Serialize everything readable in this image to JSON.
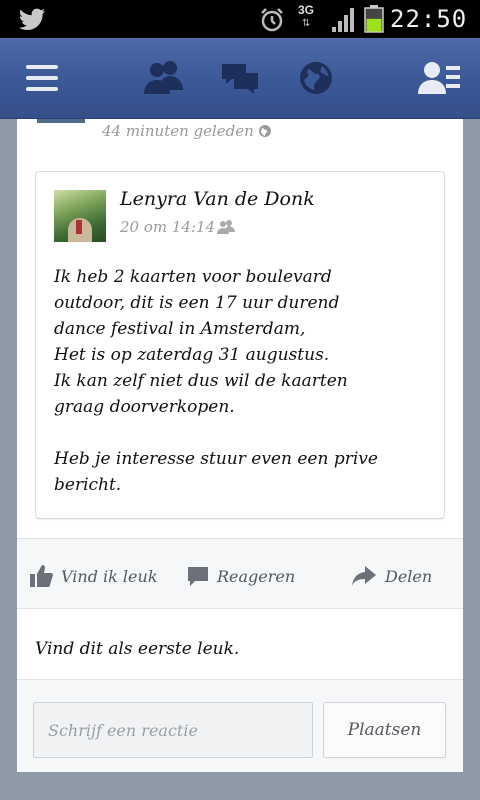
{
  "status_bar": {
    "network": "3G",
    "network_arrows": "⇅",
    "battery_level": 0.55,
    "time": "22:50",
    "colors": {
      "battery": "#9be21a"
    }
  },
  "top_nav": {
    "icons": [
      "menu-icon",
      "friends-icon",
      "messages-icon",
      "globe-icon",
      "profile-list-icon"
    ],
    "color": "#3b5897"
  },
  "previous_post": {
    "time": "44 minuten geleden",
    "privacy_icon": "globe-icon"
  },
  "shared_post": {
    "author": "Lenyra Van de Donk",
    "time": "20 om 14:14",
    "privacy_icon": "friends-icon",
    "body": "Ik heb 2 kaarten voor boulevard\noutdoor,  dit is een 17 uur durend\ndance festival in Amsterdam,\nHet is op zaterdag 31 augustus.\nIk kan zelf niet dus wil de kaarten\ngraag doorverkopen.\n\nHeb je interesse stuur even een prive\nbericht."
  },
  "actions": {
    "like": "Vind ik leuk",
    "comment": "Reageren",
    "share": "Delen"
  },
  "likes_text": "Vind dit als eerste leuk.",
  "comment_box": {
    "placeholder": "Schrijf een reactie",
    "value": "",
    "submit_label": "Plaatsen"
  }
}
